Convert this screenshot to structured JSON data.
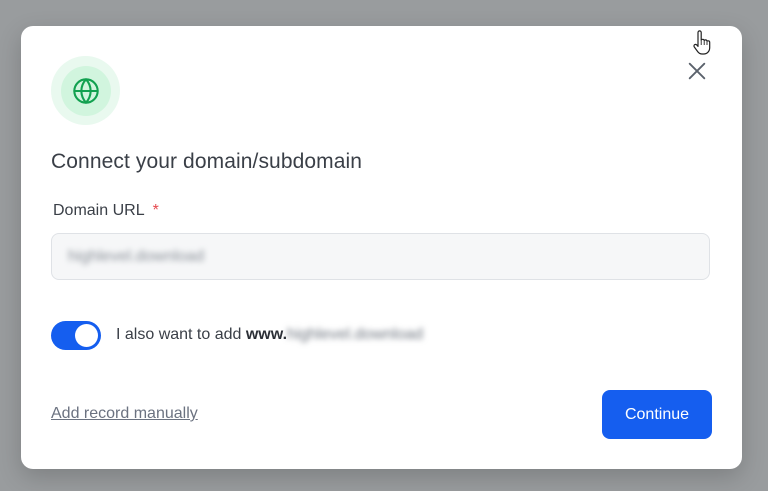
{
  "dialog": {
    "title": "Connect your domain/subdomain",
    "icon": "globe-icon",
    "close_icon": "close-icon",
    "field": {
      "label": "Domain URL",
      "required_mark": "*",
      "value": "highlevel.download"
    },
    "toggle": {
      "on": true,
      "label_prefix": "I also want to add ",
      "label_www": "www.",
      "label_domain": "highlevel.download"
    },
    "manual_link": "Add record manually",
    "continue_label": "Continue"
  },
  "colors": {
    "accent": "#155eef",
    "icon_green": "#12a150",
    "icon_bg": "#e9f9ef",
    "required": "#e5484d",
    "overlay": "#999c9e"
  }
}
